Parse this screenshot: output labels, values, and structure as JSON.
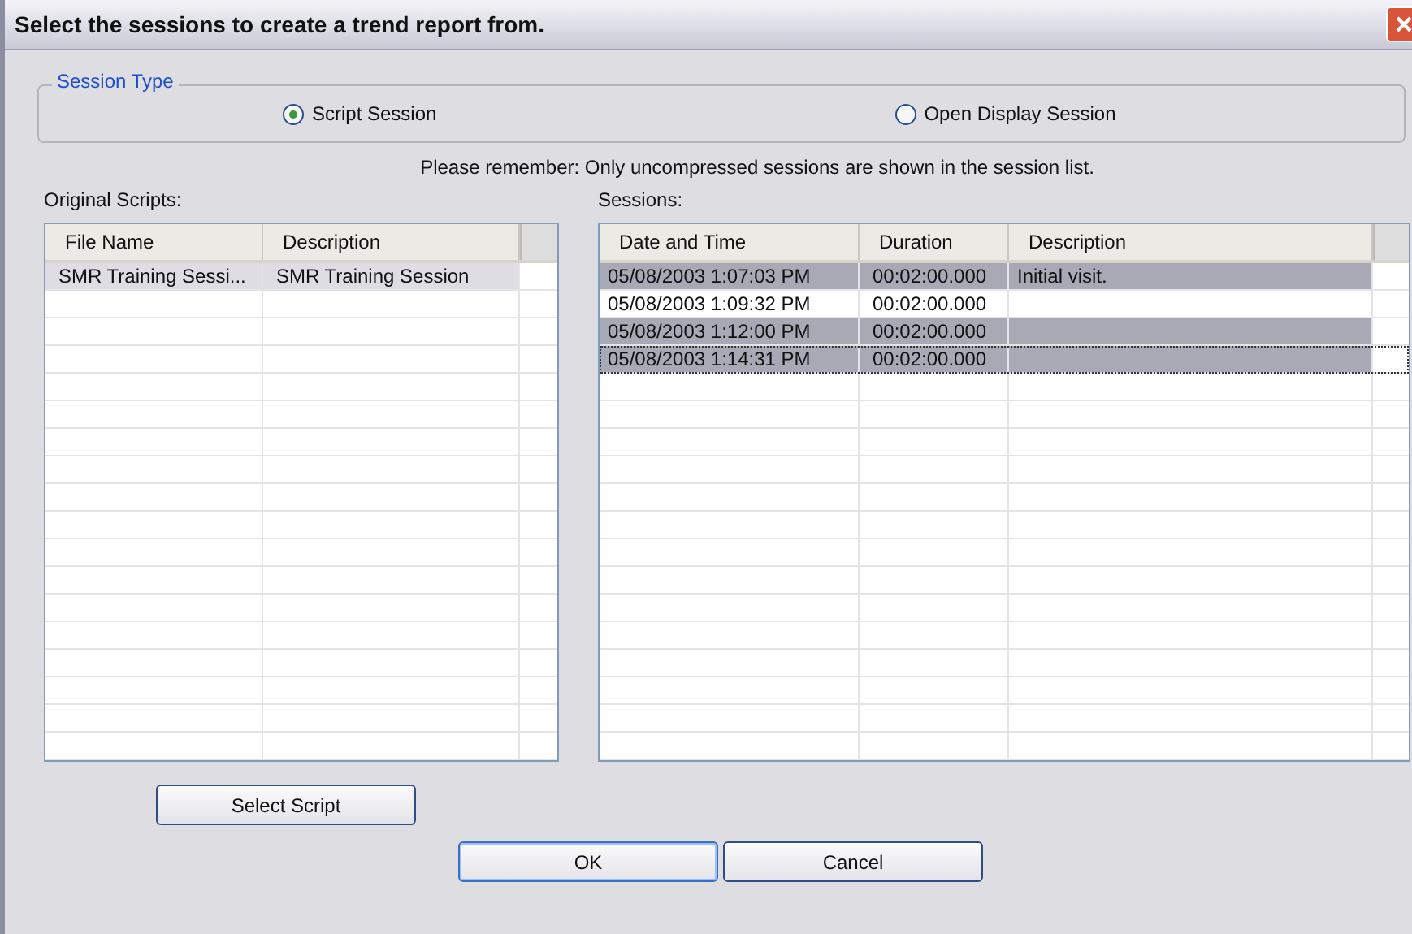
{
  "window": {
    "title": "Select the sessions to create a trend report from."
  },
  "session_type": {
    "label": "Session Type",
    "options": [
      {
        "label": "Script Session",
        "selected": true
      },
      {
        "label": "Open Display Session",
        "selected": false
      }
    ]
  },
  "notice": "Please remember: Only uncompressed sessions are shown in the session list.",
  "scripts": {
    "label": "Original Scripts:",
    "columns": [
      "File Name",
      "Description"
    ],
    "rows": [
      {
        "cells": [
          "SMR Training Sessi...",
          "SMR Training Session"
        ],
        "selected": true
      }
    ]
  },
  "sessions": {
    "label": "Sessions:",
    "columns": [
      "Date and Time",
      "Duration",
      "Description"
    ],
    "rows": [
      {
        "cells": [
          "05/08/2003 1:07:03 PM",
          "00:02:00.000",
          "Initial visit."
        ],
        "selected": true,
        "focused": false
      },
      {
        "cells": [
          "05/08/2003 1:09:32 PM",
          "00:02:00.000"
        ],
        "selected": false,
        "focused": false
      },
      {
        "cells": [
          "05/08/2003 1:12:00 PM",
          "00:02:00.000"
        ],
        "selected": true,
        "focused": false
      },
      {
        "cells": [
          "05/08/2003 1:14:31 PM",
          "00:02:00.000"
        ],
        "selected": true,
        "focused": true
      }
    ]
  },
  "buttons": {
    "select_script": "Select Script",
    "ok": "OK",
    "cancel": "Cancel"
  }
}
